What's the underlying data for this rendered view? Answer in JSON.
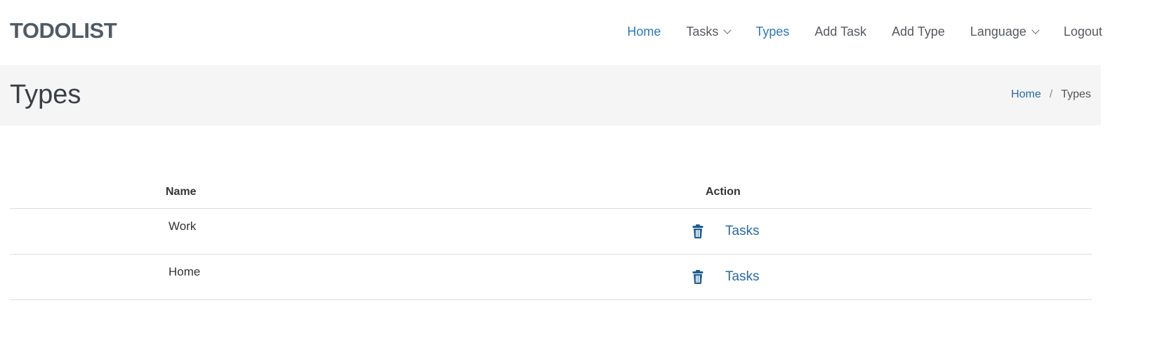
{
  "header": {
    "brand": "TODOLIST",
    "nav": [
      {
        "label": "Home",
        "active": true,
        "dropdown": false
      },
      {
        "label": "Tasks",
        "active": false,
        "dropdown": true
      },
      {
        "label": "Types",
        "active": true,
        "dropdown": false
      },
      {
        "label": "Add Task",
        "active": false,
        "dropdown": false
      },
      {
        "label": "Add Type",
        "active": false,
        "dropdown": false
      },
      {
        "label": "Language",
        "active": false,
        "dropdown": true
      },
      {
        "label": "Logout",
        "active": false,
        "dropdown": false
      }
    ]
  },
  "title_bar": {
    "title": "Types",
    "breadcrumb": {
      "home": "Home",
      "separator": "/",
      "current": "Types"
    }
  },
  "table": {
    "columns": [
      "Name",
      "Action"
    ],
    "rows": [
      {
        "name": "Work",
        "action_link": "Tasks",
        "icon": "trash-icon"
      },
      {
        "name": "Home",
        "action_link": "Tasks",
        "icon": "trash-icon"
      }
    ]
  },
  "colors": {
    "link": "#2a6aa0",
    "nav_active": "#2a7ab8",
    "brand": "#4f5b66",
    "title_bar_bg": "#f5f5f5"
  }
}
